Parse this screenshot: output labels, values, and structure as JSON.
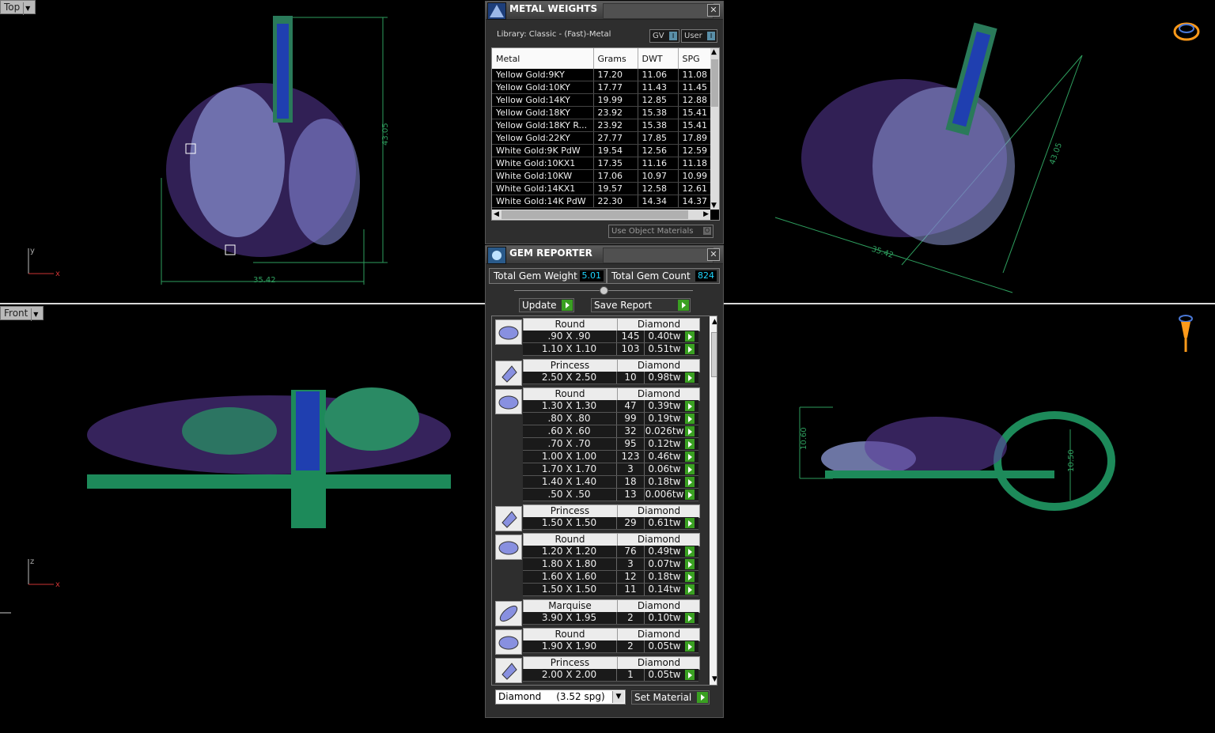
{
  "viewports": {
    "top": {
      "label": "Top",
      "dims": {
        "height": "43.05",
        "width": "35.42"
      },
      "axes": {
        "v": "y",
        "h": "x"
      }
    },
    "front": {
      "label": "Front",
      "axes": {
        "v": "z",
        "h": "x"
      }
    },
    "perspective": {
      "dims": {
        "height": "43.05",
        "width": "35.42"
      }
    },
    "right": {
      "dims": {
        "height": "10.60",
        "loop": "10.50"
      }
    }
  },
  "metal_weights": {
    "title": "METAL WEIGHTS",
    "library": "Library: Classic - (Fast)-Metal",
    "chip_gv": "GV",
    "chip_user": "User",
    "columns": [
      "Metal",
      "Grams",
      "DWT",
      "SPG"
    ],
    "rows": [
      {
        "metal": "Yellow Gold:9KY",
        "grams": "17.20",
        "dwt": "11.06",
        "spg": "11.08"
      },
      {
        "metal": "Yellow Gold:10KY",
        "grams": "17.77",
        "dwt": "11.43",
        "spg": "11.45"
      },
      {
        "metal": "Yellow Gold:14KY",
        "grams": "19.99",
        "dwt": "12.85",
        "spg": "12.88"
      },
      {
        "metal": "Yellow Gold:18KY",
        "grams": "23.92",
        "dwt": "15.38",
        "spg": "15.41"
      },
      {
        "metal": "Yellow Gold:18KY R...",
        "grams": "23.92",
        "dwt": "15.38",
        "spg": "15.41"
      },
      {
        "metal": "Yellow Gold:22KY",
        "grams": "27.77",
        "dwt": "17.85",
        "spg": "17.89"
      },
      {
        "metal": "White Gold:9K PdW",
        "grams": "19.54",
        "dwt": "12.56",
        "spg": "12.59"
      },
      {
        "metal": "White Gold:10KX1",
        "grams": "17.35",
        "dwt": "11.16",
        "spg": "11.18"
      },
      {
        "metal": "White Gold:10KW",
        "grams": "17.06",
        "dwt": "10.97",
        "spg": "10.99"
      },
      {
        "metal": "White Gold:14KX1",
        "grams": "19.57",
        "dwt": "12.58",
        "spg": "12.61"
      },
      {
        "metal": "White Gold:14K PdW",
        "grams": "22.30",
        "dwt": "14.34",
        "spg": "14.37"
      }
    ],
    "use_object_materials": "Use Object Materials"
  },
  "gem_reporter": {
    "title": "GEM REPORTER",
    "total_weight_label": "Total Gem Weight",
    "total_weight": "5.01",
    "total_count_label": "Total Gem Count",
    "total_count": "824",
    "update_label": "Update",
    "save_label": "Save Report",
    "groups": [
      {
        "shape": "Round",
        "material": "Diamond",
        "rows": [
          {
            "size": ".90 X .90",
            "count": "145",
            "weight": "0.40tw"
          },
          {
            "size": "1.10 X 1.10",
            "count": "103",
            "weight": "0.51tw"
          }
        ]
      },
      {
        "shape": "Princess",
        "material": "Diamond",
        "rows": [
          {
            "size": "2.50 X 2.50",
            "count": "10",
            "weight": "0.98tw"
          }
        ]
      },
      {
        "shape": "Round",
        "material": "Diamond",
        "rows": [
          {
            "size": "1.30 X 1.30",
            "count": "47",
            "weight": "0.39tw"
          },
          {
            "size": ".80 X .80",
            "count": "99",
            "weight": "0.19tw"
          },
          {
            "size": ".60 X .60",
            "count": "32",
            "weight": "0.026tw"
          },
          {
            "size": ".70 X .70",
            "count": "95",
            "weight": "0.12tw"
          },
          {
            "size": "1.00 X 1.00",
            "count": "123",
            "weight": "0.46tw"
          },
          {
            "size": "1.70 X 1.70",
            "count": "3",
            "weight": "0.06tw"
          },
          {
            "size": "1.40 X 1.40",
            "count": "18",
            "weight": "0.18tw"
          },
          {
            "size": ".50 X .50",
            "count": "13",
            "weight": "0.006tw"
          }
        ]
      },
      {
        "shape": "Princess",
        "material": "Diamond",
        "rows": [
          {
            "size": "1.50 X 1.50",
            "count": "29",
            "weight": "0.61tw"
          }
        ]
      },
      {
        "shape": "Round",
        "material": "Diamond",
        "rows": [
          {
            "size": "1.20 X 1.20",
            "count": "76",
            "weight": "0.49tw"
          },
          {
            "size": "1.80 X 1.80",
            "count": "3",
            "weight": "0.07tw"
          },
          {
            "size": "1.60 X 1.60",
            "count": "12",
            "weight": "0.18tw"
          },
          {
            "size": "1.50 X 1.50",
            "count": "11",
            "weight": "0.14tw"
          }
        ]
      },
      {
        "shape": "Marquise",
        "material": "Diamond",
        "rows": [
          {
            "size": "3.90 X 1.95",
            "count": "2",
            "weight": "0.10tw"
          }
        ]
      },
      {
        "shape": "Round",
        "material": "Diamond",
        "rows": [
          {
            "size": "1.90 X 1.90",
            "count": "2",
            "weight": "0.05tw"
          }
        ]
      },
      {
        "shape": "Princess",
        "material": "Diamond",
        "rows": [
          {
            "size": "2.00 X 2.00",
            "count": "1",
            "weight": "0.05tw"
          }
        ]
      }
    ],
    "material_select": "Diamond     (3.52 spg)",
    "set_material_label": "Set Material"
  }
}
